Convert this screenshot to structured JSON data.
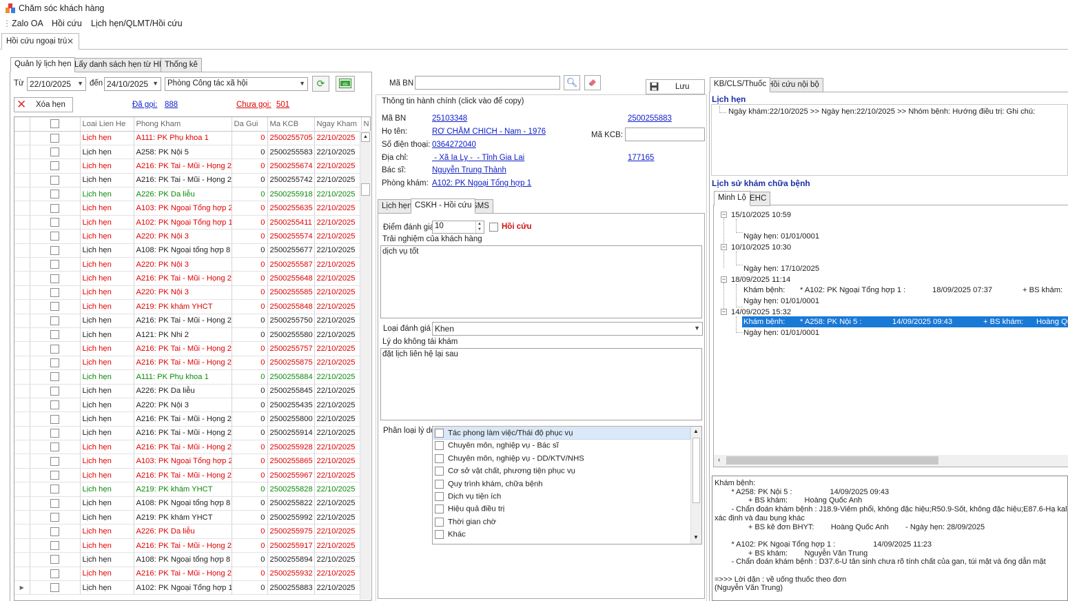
{
  "app": {
    "title": "Chăm sóc khách hàng"
  },
  "menu": [
    "Zalo OA",
    "Hồi cứu",
    "Lịch hẹn/QLMT/Hồi cứu"
  ],
  "doc_tab": {
    "label": "Hồi cứu ngoại trú"
  },
  "left_tabs": [
    "Quản lý lịch hẹn",
    "Lấy danh sách hẹn từ HIS",
    "Thống kê"
  ],
  "filter": {
    "from_label": "Từ",
    "from_date": "22/10/2025",
    "to_label": "đến",
    "to_date": "24/10/2025",
    "department": "Phòng Công tác xã hội",
    "delete_label": "Xóa hẹn",
    "called_label": "Đã gọi:",
    "called_count": "888",
    "not_called_label": "Chưa gọi:",
    "not_called_count": "501"
  },
  "grid": {
    "columns": [
      "Loai Lien He",
      "Phong Kham",
      "Da Gui",
      "Ma KCB",
      "Ngay Kham",
      "N"
    ],
    "rows": [
      {
        "type": "Lịch hẹn",
        "room": "A111: PK Phụ khoa 1",
        "sent": "0",
        "kcb": "2500255705",
        "date": "22/10/2025",
        "color": "red"
      },
      {
        "type": "Lịch hẹn",
        "room": "A258: PK Nội 5",
        "sent": "0",
        "kcb": "2500255583",
        "date": "22/10/2025",
        "color": "black"
      },
      {
        "type": "Lịch hẹn",
        "room": "A216: PK Tai - Mũi - Họng 2",
        "sent": "0",
        "kcb": "2500255674",
        "date": "22/10/2025",
        "color": "red"
      },
      {
        "type": "Lịch hẹn",
        "room": "A216: PK Tai - Mũi - Họng 2",
        "sent": "0",
        "kcb": "2500255742",
        "date": "22/10/2025",
        "color": "black"
      },
      {
        "type": "Lịch hẹn",
        "room": "A226: PK Da liễu",
        "sent": "0",
        "kcb": "2500255918",
        "date": "22/10/2025",
        "color": "green"
      },
      {
        "type": "Lịch hẹn",
        "room": "A103: PK Ngoại Tổng hợp 2",
        "sent": "0",
        "kcb": "2500255635",
        "date": "22/10/2025",
        "color": "red"
      },
      {
        "type": "Lịch hẹn",
        "room": "A102: PK Ngoại Tổng hợp 1",
        "sent": "0",
        "kcb": "2500255411",
        "date": "22/10/2025",
        "color": "red"
      },
      {
        "type": "Lịch hẹn",
        "room": "A220: PK Nội 3",
        "sent": "0",
        "kcb": "2500255574",
        "date": "22/10/2025",
        "color": "red"
      },
      {
        "type": "Lịch hẹn",
        "room": "A108: PK Ngoại tổng hợp 8",
        "sent": "0",
        "kcb": "2500255677",
        "date": "22/10/2025",
        "color": "black"
      },
      {
        "type": "Lịch hẹn",
        "room": "A220: PK Nội 3",
        "sent": "0",
        "kcb": "2500255587",
        "date": "22/10/2025",
        "color": "red"
      },
      {
        "type": "Lịch hẹn",
        "room": "A216: PK Tai - Mũi - Họng 2",
        "sent": "0",
        "kcb": "2500255648",
        "date": "22/10/2025",
        "color": "red"
      },
      {
        "type": "Lịch hẹn",
        "room": "A220: PK Nội 3",
        "sent": "0",
        "kcb": "2500255585",
        "date": "22/10/2025",
        "color": "red"
      },
      {
        "type": "Lịch hẹn",
        "room": "A219: PK khám YHCT",
        "sent": "0",
        "kcb": "2500255848",
        "date": "22/10/2025",
        "color": "red"
      },
      {
        "type": "Lịch hẹn",
        "room": "A216: PK Tai - Mũi - Họng 2",
        "sent": "0",
        "kcb": "2500255750",
        "date": "22/10/2025",
        "color": "black"
      },
      {
        "type": "Lịch hẹn",
        "room": "A121: PK Nhi 2",
        "sent": "0",
        "kcb": "2500255580",
        "date": "22/10/2025",
        "color": "black"
      },
      {
        "type": "Lịch hẹn",
        "room": "A216: PK Tai - Mũi - Họng 2",
        "sent": "0",
        "kcb": "2500255757",
        "date": "22/10/2025",
        "color": "red"
      },
      {
        "type": "Lịch hẹn",
        "room": "A216: PK Tai - Mũi - Họng 2",
        "sent": "0",
        "kcb": "2500255875",
        "date": "22/10/2025",
        "color": "red"
      },
      {
        "type": "Lịch hẹn",
        "room": "A111: PK Phụ khoa 1",
        "sent": "0",
        "kcb": "2500255884",
        "date": "22/10/2025",
        "color": "green"
      },
      {
        "type": "Lịch hẹn",
        "room": "A226: PK Da liễu",
        "sent": "0",
        "kcb": "2500255845",
        "date": "22/10/2025",
        "color": "black"
      },
      {
        "type": "Lịch hẹn",
        "room": "A220: PK Nội 3",
        "sent": "0",
        "kcb": "2500255435",
        "date": "22/10/2025",
        "color": "black"
      },
      {
        "type": "Lịch hẹn",
        "room": "A216: PK Tai - Mũi - Họng 2",
        "sent": "0",
        "kcb": "2500255800",
        "date": "22/10/2025",
        "color": "black"
      },
      {
        "type": "Lịch hẹn",
        "room": "A216: PK Tai - Mũi - Họng 2",
        "sent": "0",
        "kcb": "2500255914",
        "date": "22/10/2025",
        "color": "black"
      },
      {
        "type": "Lịch hẹn",
        "room": "A216: PK Tai - Mũi - Họng 2",
        "sent": "0",
        "kcb": "2500255928",
        "date": "22/10/2025",
        "color": "red"
      },
      {
        "type": "Lịch hẹn",
        "room": "A103: PK Ngoại Tổng hợp 2",
        "sent": "0",
        "kcb": "2500255865",
        "date": "22/10/2025",
        "color": "red"
      },
      {
        "type": "Lịch hẹn",
        "room": "A216: PK Tai - Mũi - Họng 2",
        "sent": "0",
        "kcb": "2500255967",
        "date": "22/10/2025",
        "color": "red"
      },
      {
        "type": "Lịch hẹn",
        "room": "A219: PK khám YHCT",
        "sent": "0",
        "kcb": "2500255828",
        "date": "22/10/2025",
        "color": "green"
      },
      {
        "type": "Lịch hẹn",
        "room": "A108: PK Ngoại tổng hợp 8",
        "sent": "0",
        "kcb": "2500255822",
        "date": "22/10/2025",
        "color": "black"
      },
      {
        "type": "Lịch hẹn",
        "room": "A219: PK khám YHCT",
        "sent": "0",
        "kcb": "2500255992",
        "date": "22/10/2025",
        "color": "black"
      },
      {
        "type": "Lịch hẹn",
        "room": "A226: PK Da liễu",
        "sent": "0",
        "kcb": "2500255975",
        "date": "22/10/2025",
        "color": "red"
      },
      {
        "type": "Lịch hẹn",
        "room": "A216: PK Tai - Mũi - Họng 2",
        "sent": "0",
        "kcb": "2500255917",
        "date": "22/10/2025",
        "color": "red"
      },
      {
        "type": "Lịch hẹn",
        "room": "A108: PK Ngoại tổng hợp 8",
        "sent": "0",
        "kcb": "2500255894",
        "date": "22/10/2025",
        "color": "black"
      },
      {
        "type": "Lịch hẹn",
        "room": "A216: PK Tai - Mũi - Họng 2",
        "sent": "0",
        "kcb": "2500255932",
        "date": "22/10/2025",
        "color": "red"
      },
      {
        "type": "Lịch hẹn",
        "room": "A102: PK Ngoại Tổng hợp 1",
        "sent": "0",
        "kcb": "2500255883",
        "date": "22/10/2025",
        "color": "black"
      }
    ]
  },
  "search": {
    "ma_bn_label": "Mã BN",
    "ma_bn_value": "",
    "save_label": "Lưu"
  },
  "admin_info": {
    "title": "Thông tin hành chính (click vào để copy)",
    "ma_bn_label": "Mã BN",
    "ma_bn": "25103348",
    "ma_bn_2": "2500255883",
    "ho_ten_label": "Họ tên:",
    "ho_ten": "RƠ CHĂM CHICH - Nam - 1976",
    "ma_kcb_label": "Mã KCB:",
    "sdt_label": "Số điện thoại:",
    "sdt": "0364272040",
    "dia_chi_label": "Địa chỉ:",
    "dia_chi": " - Xã Ia Ly -  - Tỉnh Gia Lai",
    "dia_chi_code": "177165",
    "bac_si_label": "Bác sĩ:",
    "bac_si": "Nguyễn Trung Thành",
    "phong_kham_label": "Phòng khám:",
    "phong_kham": "A102: PK Ngoại Tổng hợp 1"
  },
  "mid_tabs": [
    "Lịch hẹn",
    "CSKH - Hồi cứu",
    "SMS"
  ],
  "cskh": {
    "score_label": "Điểm đánh giá",
    "score": "10",
    "recall_label": "Hồi cứu",
    "experience_label": "Trải nghiệm của khách hàng",
    "experience": "dịch vụ tốt",
    "rating_type_label": "Loại đánh giá",
    "rating_type": "Khen",
    "reason_label": "Lý do không tái khám",
    "reason": "đặt lịch liên hệ lại sau",
    "category_label": "Phân loại lý do",
    "categories": [
      "Tác phong làm việc/Thái độ phục vụ",
      "Chuyên môn, nghiệp vụ - Bác sĩ",
      "Chuyên môn, nghiệp vụ - DD/KTV/NHS",
      "Cơ sở vật chất, phương tiện phục vụ",
      "Quy trình khám, chữa bệnh",
      "Dịch vụ tiện ích",
      "Hiệu quả điều trị",
      "Thời gian chờ",
      "Khác"
    ]
  },
  "right_tabs": [
    "KB/CLS/Thuốc",
    "Hồi cứu nội bộ"
  ],
  "appointments": {
    "title": "Lịch hẹn",
    "entry": "Ngày khám:22/10/2025 >> Ngày hẹn:22/10/2025 >> Nhóm bệnh: Hướng điều trị: Ghi chú:"
  },
  "history": {
    "title": "Lịch sử khám chữa bệnh",
    "tabs": [
      "Minh Lộ",
      "EHC"
    ],
    "nodes": [
      {
        "time": "15/10/2025 10:59",
        "children": [
          "Ngày hẹn: 01/01/0001"
        ]
      },
      {
        "time": "10/10/2025 10:30",
        "children": [
          "Ngày hẹn: 17/10/2025"
        ]
      },
      {
        "time": "18/09/2025 11:14",
        "exam": "Khám bệnh:",
        "exam_room": "* A102: PK Ngoại Tổng hợp 1 :",
        "exam_time": "18/09/2025 07:37",
        "exam_doc": "+ BS khám:",
        "children": [
          "Ngày hẹn: 01/01/0001"
        ]
      },
      {
        "time": "14/09/2025 15:32",
        "exam": "Khám bệnh:",
        "exam_room": "* A258: PK Nội 5 :",
        "exam_time": "14/09/2025 09:43",
        "exam_doc": "+ BS khám:",
        "exam_doc_name": "Hoàng Qu",
        "children": [
          "Ngày hẹn: 01/01/0001"
        ]
      }
    ]
  },
  "detail": {
    "lines": [
      "Khám bệnh:",
      "        * A258: PK Nội 5 :                  14/09/2025 09:43",
      "                + BS khám:        Hoàng Quốc Anh",
      "        - Chẩn đoán khám bệnh : J18.9-Viêm phổi, không đặc hiệu;R50.9-Sốt, không đặc hiệu;E87.6-Hạ kali máu;",
      "xác định và đau bụng khác",
      "                + BS kê đơn BHYT:        Hoàng Quốc Anh        - Ngày hẹn: 28/09/2025",
      "",
      "        * A102: PK Ngoại Tổng hợp 1 :                  14/09/2025 11:23",
      "                + BS khám:        Nguyễn Văn Trung",
      "        - Chẩn đoán khám bệnh : D37.6-U tân sinh chưa rõ tính chất của gan, túi mật và ống dẫn mật",
      "",
      "=>>> Lời dặn : về uống thuốc theo đơn",
      "(Nguyễn Văn Trung)"
    ]
  },
  "colors": {
    "red": "#e00000",
    "green": "#0a8a0a",
    "link": "#1020c8",
    "section": "#1d2fa8",
    "selected": "#1979d7"
  }
}
